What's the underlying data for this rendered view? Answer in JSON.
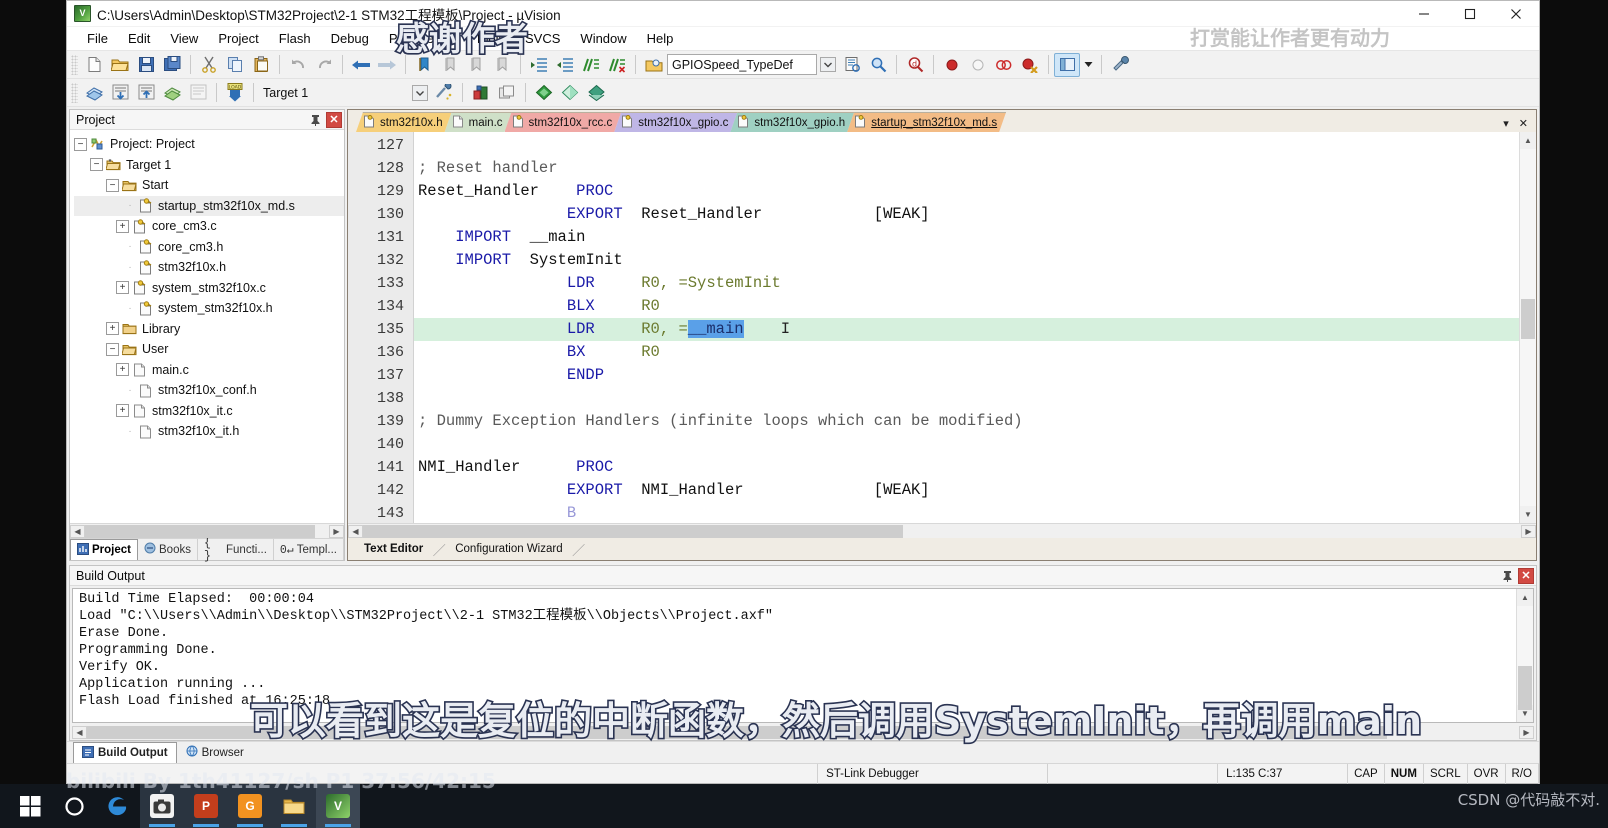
{
  "window": {
    "title": "C:\\Users\\Admin\\Desktop\\STM32Project\\2-1 STM32工程模板\\Project - µVision",
    "app_icon": "uvision-icon",
    "minimize": "minimize-button",
    "maximize": "maximize-button",
    "close": "close-button"
  },
  "menubar": {
    "items": [
      {
        "label": "File"
      },
      {
        "label": "Edit"
      },
      {
        "label": "View"
      },
      {
        "label": "Project"
      },
      {
        "label": "Flash"
      },
      {
        "label": "Debug"
      },
      {
        "label": "Peripherals"
      },
      {
        "label": "Tools"
      },
      {
        "label": "SVCS"
      },
      {
        "label": "Window"
      },
      {
        "label": "Help"
      }
    ]
  },
  "toolbar_main": {
    "search_combo_value": "GPIOSpeed_TypeDef",
    "buttons": [
      {
        "name": "new-file-icon"
      },
      {
        "name": "open-file-icon"
      },
      {
        "name": "save-icon"
      },
      {
        "name": "save-all-icon"
      },
      {
        "name": "cut-icon"
      },
      {
        "name": "copy-icon"
      },
      {
        "name": "paste-icon"
      },
      {
        "name": "undo-icon"
      },
      {
        "name": "redo-icon"
      },
      {
        "name": "navigate-back-icon"
      },
      {
        "name": "navigate-forward-icon"
      },
      {
        "name": "bookmark-toggle-icon"
      },
      {
        "name": "bookmark-prev-icon"
      },
      {
        "name": "bookmark-next-icon"
      },
      {
        "name": "bookmark-clear-icon"
      },
      {
        "name": "indent-icon"
      },
      {
        "name": "outdent-icon"
      },
      {
        "name": "comment-icon"
      },
      {
        "name": "uncomment-icon"
      }
    ]
  },
  "toolbar_debug": {
    "target_value": "Target 1"
  },
  "project_pane": {
    "header": "Project",
    "pin_icon": "pin-icon",
    "close_icon": "close-icon",
    "tree": [
      {
        "depth": 0,
        "label": "Project: Project",
        "expander": "-",
        "icon": "project-icon"
      },
      {
        "depth": 1,
        "label": "Target 1",
        "expander": "-",
        "icon": "target-folder-icon"
      },
      {
        "depth": 2,
        "label": "Start",
        "expander": "-",
        "icon": "folder-icon"
      },
      {
        "depth": 3,
        "label": "startup_stm32f10x_md.s",
        "expander": "",
        "icon": "asm-file-icon",
        "selected": true
      },
      {
        "depth": 3,
        "label": "core_cm3.c",
        "expander": "+",
        "icon": "c-file-icon"
      },
      {
        "depth": 3,
        "label": "core_cm3.h",
        "expander": "",
        "icon": "h-file-icon"
      },
      {
        "depth": 3,
        "label": "stm32f10x.h",
        "expander": "",
        "icon": "h-file-icon"
      },
      {
        "depth": 3,
        "label": "system_stm32f10x.c",
        "expander": "+",
        "icon": "c-file-icon"
      },
      {
        "depth": 3,
        "label": "system_stm32f10x.h",
        "expander": "",
        "icon": "h-file-icon"
      },
      {
        "depth": 2,
        "label": "Library",
        "expander": "+",
        "icon": "folder-icon"
      },
      {
        "depth": 2,
        "label": "User",
        "expander": "-",
        "icon": "folder-icon"
      },
      {
        "depth": 3,
        "label": "main.c",
        "expander": "+",
        "icon": "plain-file-icon"
      },
      {
        "depth": 3,
        "label": "stm32f10x_conf.h",
        "expander": "",
        "icon": "plain-file-icon"
      },
      {
        "depth": 3,
        "label": "stm32f10x_it.c",
        "expander": "+",
        "icon": "plain-file-icon"
      },
      {
        "depth": 3,
        "label": "stm32f10x_it.h",
        "expander": "",
        "icon": "plain-file-icon"
      }
    ],
    "tabs": [
      {
        "label": "Project",
        "icon": "project-tab-icon",
        "active": true
      },
      {
        "label": "Books",
        "icon": "books-tab-icon",
        "active": false
      },
      {
        "label": "Functi...",
        "icon": "functions-tab-icon",
        "active": false
      },
      {
        "label": "Templ...",
        "icon": "templates-tab-icon",
        "active": false
      }
    ]
  },
  "editor": {
    "doc_tabs": [
      {
        "label": "stm32f10x.h",
        "color": "#f6cf7a",
        "active": false
      },
      {
        "label": "main.c",
        "color": "#cfe0c8",
        "active": false
      },
      {
        "label": "stm32f10x_rcc.c",
        "color": "#f0a9a6",
        "active": false
      },
      {
        "label": "stm32f10x_gpio.c",
        "color": "#bfb6e6",
        "active": false
      },
      {
        "label": "stm32f10x_gpio.h",
        "color": "#9fd0c2",
        "active": false
      },
      {
        "label": "startup_stm32f10x_md.s",
        "color": "#f3bc86",
        "active": true
      }
    ],
    "first_line_number": 127,
    "highlighted_line": 135,
    "selected_token": "__main",
    "lines": [
      {
        "n": 127,
        "segments": []
      },
      {
        "n": 128,
        "segments": [
          {
            "t": "; Reset handler",
            "c": "cm"
          }
        ]
      },
      {
        "n": 129,
        "segments": [
          {
            "t": "Reset_Handler",
            "c": "id"
          },
          {
            "t": "    ",
            "c": "id"
          },
          {
            "t": "PROC",
            "c": "kw"
          }
        ]
      },
      {
        "n": 130,
        "segments": [
          {
            "t": "                ",
            "c": "id"
          },
          {
            "t": "EXPORT",
            "c": "kw"
          },
          {
            "t": "  Reset_Handler",
            "c": "id"
          },
          {
            "t": "            ",
            "c": "id"
          },
          {
            "t": "[WEAK]",
            "c": "id"
          }
        ]
      },
      {
        "n": 131,
        "segments": [
          {
            "t": "    ",
            "c": "id"
          },
          {
            "t": "IMPORT",
            "c": "kw"
          },
          {
            "t": "  __main",
            "c": "id"
          }
        ]
      },
      {
        "n": 132,
        "segments": [
          {
            "t": "    ",
            "c": "id"
          },
          {
            "t": "IMPORT",
            "c": "kw"
          },
          {
            "t": "  SystemInit",
            "c": "id"
          }
        ]
      },
      {
        "n": 133,
        "segments": [
          {
            "t": "                ",
            "c": "id"
          },
          {
            "t": "LDR",
            "c": "kw"
          },
          {
            "t": "     ",
            "c": "id"
          },
          {
            "t": "R0, =SystemInit",
            "c": "reg"
          }
        ]
      },
      {
        "n": 134,
        "segments": [
          {
            "t": "                ",
            "c": "id"
          },
          {
            "t": "BLX",
            "c": "kw"
          },
          {
            "t": "     ",
            "c": "id"
          },
          {
            "t": "R0",
            "c": "reg"
          }
        ]
      },
      {
        "n": 135,
        "segments": [
          {
            "t": "                ",
            "c": "id"
          },
          {
            "t": "LDR",
            "c": "kw"
          },
          {
            "t": "     ",
            "c": "id"
          },
          {
            "t": "R0, =",
            "c": "reg"
          },
          {
            "t": "__main",
            "c": "selwd"
          }
        ]
      },
      {
        "n": 136,
        "segments": [
          {
            "t": "                ",
            "c": "id"
          },
          {
            "t": "BX",
            "c": "kw"
          },
          {
            "t": "      ",
            "c": "id"
          },
          {
            "t": "R0",
            "c": "reg"
          }
        ]
      },
      {
        "n": 137,
        "segments": [
          {
            "t": "                ",
            "c": "id"
          },
          {
            "t": "ENDP",
            "c": "kw"
          }
        ]
      },
      {
        "n": 138,
        "segments": []
      },
      {
        "n": 139,
        "segments": [
          {
            "t": "; Dummy Exception Handlers (infinite loops which can be modified)",
            "c": "cm"
          }
        ]
      },
      {
        "n": 140,
        "segments": []
      },
      {
        "n": 141,
        "segments": [
          {
            "t": "NMI_Handler",
            "c": "id"
          },
          {
            "t": "      ",
            "c": "id"
          },
          {
            "t": "PROC",
            "c": "kw"
          }
        ]
      },
      {
        "n": 142,
        "segments": [
          {
            "t": "                ",
            "c": "id"
          },
          {
            "t": "EXPORT",
            "c": "kw"
          },
          {
            "t": "  NMI_Handler",
            "c": "id"
          },
          {
            "t": "              ",
            "c": "id"
          },
          {
            "t": "[WEAK]",
            "c": "id"
          }
        ]
      },
      {
        "n": 143,
        "segments": [
          {
            "t": "                ",
            "c": "id"
          },
          {
            "t": "B",
            "c": "kw"
          }
        ]
      }
    ],
    "view_tabs": [
      {
        "label": "Text Editor",
        "active": true
      },
      {
        "label": "Configuration Wizard",
        "active": false
      }
    ]
  },
  "build_output": {
    "header": "Build Output",
    "pin_icon": "pin-icon",
    "close_icon": "close-icon",
    "lines": [
      "Build Time Elapsed:  00:00:04",
      "Load \"C:\\\\Users\\\\Admin\\\\Desktop\\\\STM32Project\\\\2-1 STM32工程模板\\\\Objects\\\\Project.axf\"",
      "Erase Done.",
      "Programming Done.",
      "Verify OK.",
      "Application running ...",
      "Flash Load finished at 16:25:18"
    ],
    "tabs": [
      {
        "label": "Build Output",
        "icon": "build-output-icon",
        "active": true
      },
      {
        "label": "Browser",
        "icon": "browser-icon",
        "active": false
      }
    ]
  },
  "status_bar": {
    "message": "",
    "debugger": "ST-Link Debugger",
    "position": "L:135 C:37",
    "flags": [
      {
        "label": "CAP",
        "bold": false
      },
      {
        "label": "NUM",
        "bold": true
      },
      {
        "label": "SCRL",
        "bold": false
      },
      {
        "label": "OVR",
        "bold": false
      },
      {
        "label": "R/O",
        "bold": false
      }
    ]
  },
  "taskbar": {
    "items": [
      {
        "name": "start-button",
        "glyph": "⊞",
        "color": "#11161c",
        "running": false
      },
      {
        "name": "cortana-search-icon",
        "glyph": "◯",
        "color": "#11161c",
        "running": false
      },
      {
        "name": "edge-browser-icon",
        "glyph": "e",
        "color": "#11161c",
        "running": false
      },
      {
        "name": "camera-app-icon",
        "glyph": "◉",
        "color": "#3c4350",
        "running": true
      },
      {
        "name": "powerpoint-icon",
        "glyph": "P",
        "color": "#c43e1c",
        "running": true
      },
      {
        "name": "gif-tool-icon",
        "glyph": "G",
        "color": "#f29220",
        "running": true
      },
      {
        "name": "file-explorer-icon",
        "glyph": "▤",
        "color": "#e8b84b",
        "running": true
      },
      {
        "name": "keil-uvision-icon",
        "glyph": "V",
        "color": "#2f6b33",
        "running": true
      }
    ]
  },
  "overlays": {
    "subtitle_top": "感谢作者",
    "subtitle_main": "可以看到这是复位的中断函数，然后调用SystemInit，再调用main",
    "watermark_title": "打赏能让作者更有动力",
    "watermark_bili": "bilibili By 1th41127/sh P1 37:56/42:15",
    "watermark_csdn": "CSDN @代码敲不对."
  }
}
